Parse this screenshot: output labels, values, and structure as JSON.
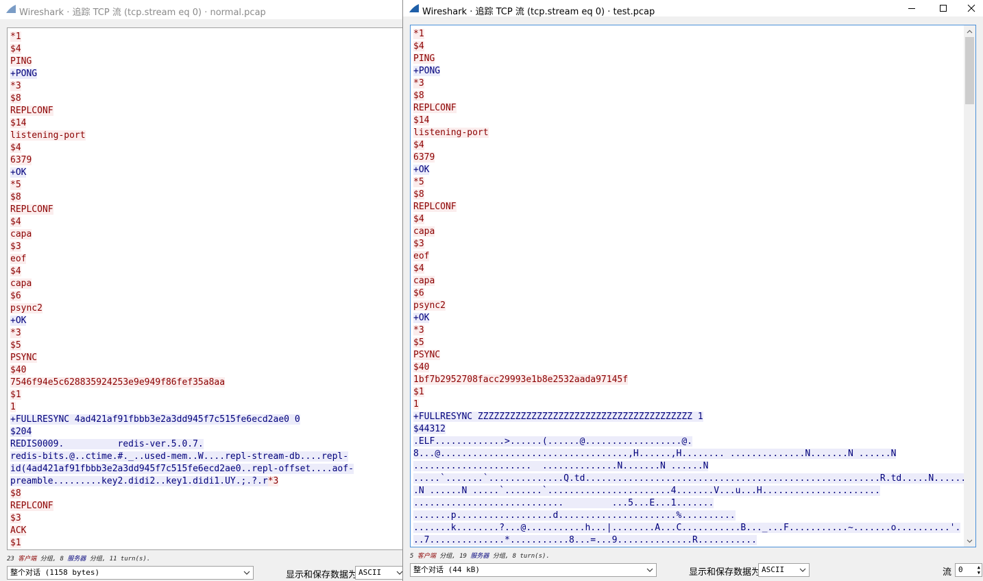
{
  "left": {
    "title": "Wireshark · 追踪 TCP 流 (tcp.stream eq 0) · normal.pcap",
    "lines": [
      [
        {
          "t": "*1",
          "k": "c"
        }
      ],
      [
        {
          "t": "$4",
          "k": "c"
        }
      ],
      [
        {
          "t": "PING",
          "k": "c"
        }
      ],
      [
        {
          "t": "+PONG",
          "k": "s"
        }
      ],
      [
        {
          "t": "*3",
          "k": "c"
        }
      ],
      [
        {
          "t": "$8",
          "k": "c"
        }
      ],
      [
        {
          "t": "REPLCONF",
          "k": "c"
        }
      ],
      [
        {
          "t": "$14",
          "k": "c"
        }
      ],
      [
        {
          "t": "listening-port",
          "k": "c"
        }
      ],
      [
        {
          "t": "$4",
          "k": "c"
        }
      ],
      [
        {
          "t": "6379",
          "k": "c"
        }
      ],
      [
        {
          "t": "+OK",
          "k": "s"
        }
      ],
      [
        {
          "t": "*5",
          "k": "c"
        }
      ],
      [
        {
          "t": "$8",
          "k": "c"
        }
      ],
      [
        {
          "t": "REPLCONF",
          "k": "c"
        }
      ],
      [
        {
          "t": "$4",
          "k": "c"
        }
      ],
      [
        {
          "t": "capa",
          "k": "c"
        }
      ],
      [
        {
          "t": "$3",
          "k": "c"
        }
      ],
      [
        {
          "t": "eof",
          "k": "c"
        }
      ],
      [
        {
          "t": "$4",
          "k": "c"
        }
      ],
      [
        {
          "t": "capa",
          "k": "c"
        }
      ],
      [
        {
          "t": "$6",
          "k": "c"
        }
      ],
      [
        {
          "t": "psync2",
          "k": "c"
        }
      ],
      [
        {
          "t": "+OK",
          "k": "s"
        }
      ],
      [
        {
          "t": "*3",
          "k": "c"
        }
      ],
      [
        {
          "t": "$5",
          "k": "c"
        }
      ],
      [
        {
          "t": "PSYNC",
          "k": "c"
        }
      ],
      [
        {
          "t": "$40",
          "k": "c"
        }
      ],
      [
        {
          "t": "7546f94e5c628835924253e9e949f86fef35a8aa",
          "k": "c"
        }
      ],
      [
        {
          "t": "$1",
          "k": "c"
        }
      ],
      [
        {
          "t": "1",
          "k": "c"
        }
      ],
      [
        {
          "t": "+FULLRESYNC 4ad421af91fbbb3e2a3dd945f7c515fe6ecd2ae0 0",
          "k": "s"
        }
      ],
      [
        {
          "t": "$204",
          "k": "s"
        }
      ],
      [
        {
          "t": "REDIS0009.          redis-ver.5.0.7.",
          "k": "s"
        }
      ],
      [
        {
          "t": "redis-bits.@..ctime.#._..used-mem..W....repl-stream-db....repl-",
          "k": "s"
        }
      ],
      [
        {
          "t": "id(4ad421af91fbbb3e2a3dd945f7c515fe6ecd2ae0..repl-offset....aof-",
          "k": "s"
        }
      ],
      [
        {
          "t": "preamble.........key2.didi2..key1.didi1.UY.;.?.r",
          "k": "s"
        },
        {
          "t": "*3",
          "k": "c"
        }
      ],
      [
        {
          "t": "$8",
          "k": "c"
        }
      ],
      [
        {
          "t": "REPLCONF",
          "k": "c"
        }
      ],
      [
        {
          "t": "$3",
          "k": "c"
        }
      ],
      [
        {
          "t": "ACK",
          "k": "c"
        }
      ],
      [
        {
          "t": "$1",
          "k": "c"
        }
      ]
    ],
    "summary": {
      "client_count": "23",
      "client_word": "客户端",
      "pkt_word1": "分组,",
      "server_count": "8",
      "server_word": "服务器",
      "pkt_word2": "分组,",
      "turns": "11 turn(s)."
    },
    "dialog_select": "整个对话 (1158 bytes)",
    "save_label": "显示和保存数据为",
    "format_select": "ASCII"
  },
  "right": {
    "title": "Wireshark · 追踪 TCP 流 (tcp.stream eq 0) · test.pcap",
    "lines": [
      [
        {
          "t": "*1",
          "k": "c"
        }
      ],
      [
        {
          "t": "$4",
          "k": "c"
        }
      ],
      [
        {
          "t": "PING",
          "k": "c"
        }
      ],
      [
        {
          "t": "+PONG",
          "k": "s"
        }
      ],
      [
        {
          "t": "*3",
          "k": "c"
        }
      ],
      [
        {
          "t": "$8",
          "k": "c"
        }
      ],
      [
        {
          "t": "REPLCONF",
          "k": "c"
        }
      ],
      [
        {
          "t": "$14",
          "k": "c"
        }
      ],
      [
        {
          "t": "listening-port",
          "k": "c"
        }
      ],
      [
        {
          "t": "$4",
          "k": "c"
        }
      ],
      [
        {
          "t": "6379",
          "k": "c"
        }
      ],
      [
        {
          "t": "+OK",
          "k": "s"
        }
      ],
      [
        {
          "t": "*5",
          "k": "c"
        }
      ],
      [
        {
          "t": "$8",
          "k": "c"
        }
      ],
      [
        {
          "t": "REPLCONF",
          "k": "c"
        }
      ],
      [
        {
          "t": "$4",
          "k": "c"
        }
      ],
      [
        {
          "t": "capa",
          "k": "c"
        }
      ],
      [
        {
          "t": "$3",
          "k": "c"
        }
      ],
      [
        {
          "t": "eof",
          "k": "c"
        }
      ],
      [
        {
          "t": "$4",
          "k": "c"
        }
      ],
      [
        {
          "t": "capa",
          "k": "c"
        }
      ],
      [
        {
          "t": "$6",
          "k": "c"
        }
      ],
      [
        {
          "t": "psync2",
          "k": "c"
        }
      ],
      [
        {
          "t": "+OK",
          "k": "s"
        }
      ],
      [
        {
          "t": "*3",
          "k": "c"
        }
      ],
      [
        {
          "t": "$5",
          "k": "c"
        }
      ],
      [
        {
          "t": "PSYNC",
          "k": "c"
        }
      ],
      [
        {
          "t": "$40",
          "k": "c"
        }
      ],
      [
        {
          "t": "1bf7b2952708facc29993e1b8e2532aada97145f",
          "k": "c"
        }
      ],
      [
        {
          "t": "$1",
          "k": "c"
        }
      ],
      [
        {
          "t": "1",
          "k": "c"
        }
      ],
      [
        {
          "t": "+FULLRESYNC ZZZZZZZZZZZZZZZZZZZZZZZZZZZZZZZZZZZZZZZZ 1",
          "k": "s"
        }
      ],
      [
        {
          "t": "$44312",
          "k": "s"
        }
      ],
      [
        {
          "t": ".ELF.............>......(......@..................@.",
          "k": "s"
        }
      ],
      [
        {
          "t": "8...@...................................,H......,H........ ..............N.......N ......N",
          "k": "s"
        }
      ],
      [
        {
          "t": "......................  ..............N.......N ......N",
          "k": "s"
        }
      ],
      [
        {
          "t": ".....`.......`..............Q.td.......................................................R.td.....N......",
          "k": "s"
        }
      ],
      [
        {
          "t": ".N ......N .....`.......`.......................4.......V...u...H......................",
          "k": "s"
        }
      ],
      [
        {
          "t": "............................         ...5...E...1.......",
          "k": "s"
        }
      ],
      [
        {
          "t": ".......p..................d......................%..........",
          "k": "s"
        }
      ],
      [
        {
          "t": ".......k........?...@...........h...|........A...C...........B..._...F...........~.......o..........'.",
          "k": "s"
        }
      ],
      [
        {
          "t": "..7..............*...........8...=...9..............R...........",
          "k": "s"
        }
      ]
    ],
    "summary": {
      "client_count": "5",
      "client_word": "客户端",
      "pkt_word1": "分组,",
      "server_count": "19",
      "server_word": "服务器",
      "pkt_word2": "分组,",
      "turns": "8 turn(s)."
    },
    "dialog_select": "整个对话 (44 kB)",
    "save_label": "显示和保存数据为",
    "format_select": "ASCII",
    "stream_label": "流",
    "stream_value": "0"
  },
  "colors": {
    "client_fg": "#8b0000",
    "client_bg": "#fbeded",
    "server_fg": "#00007b",
    "server_bg": "#ececfa",
    "accent": "#4a90d9"
  },
  "icons": {
    "app": "wireshark-fin-icon",
    "minimize": "minimize-icon",
    "maximize": "maximize-icon",
    "close": "close-icon",
    "dropdown": "chevron-down-icon"
  }
}
